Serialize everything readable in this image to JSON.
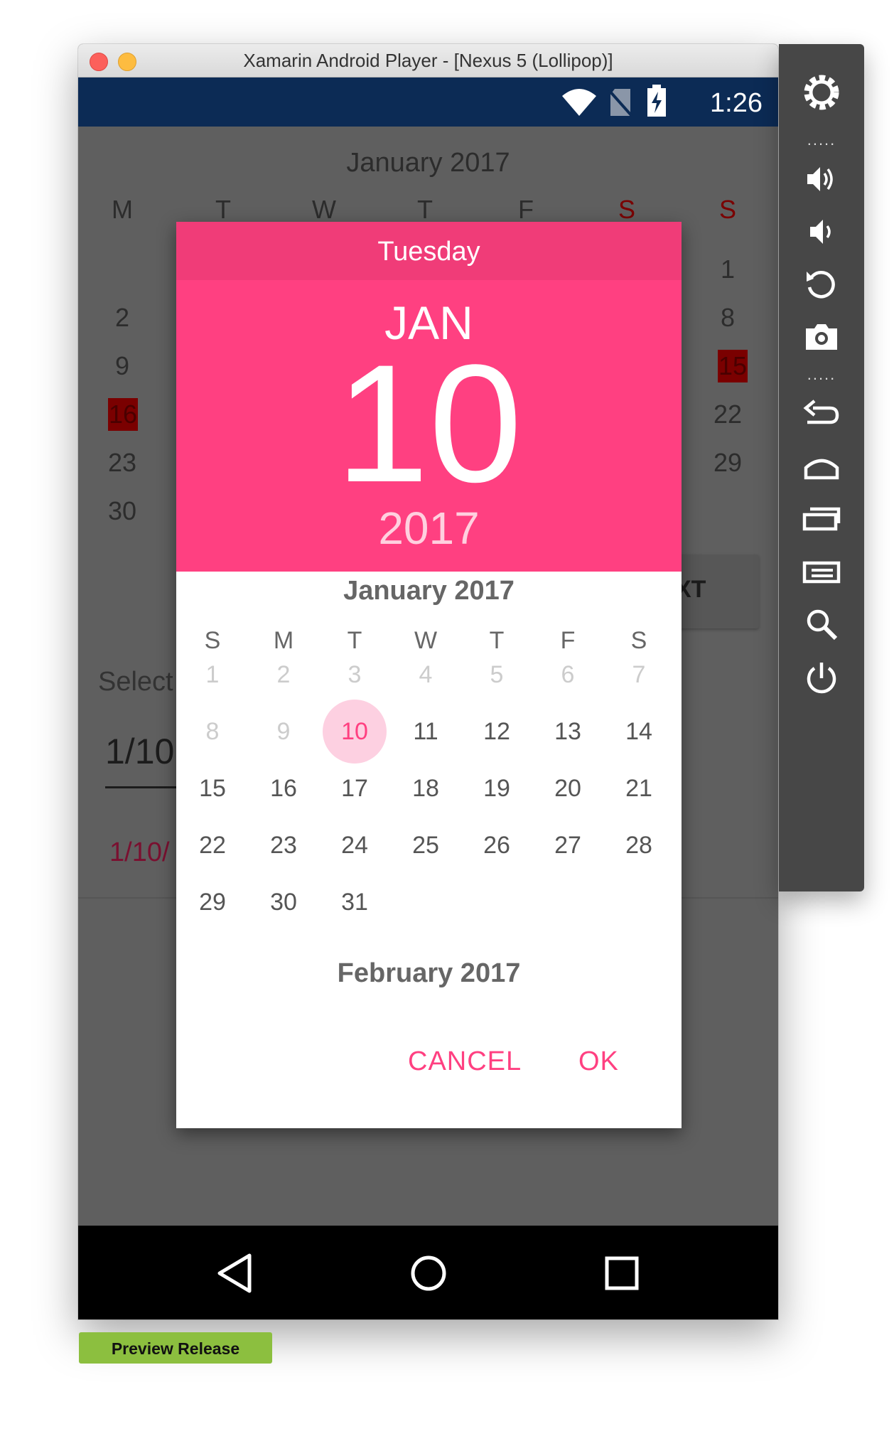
{
  "window": {
    "title": "Xamarin Android Player - [Nexus 5 (Lollipop)]"
  },
  "status_bar": {
    "time": "1:26",
    "icons": [
      "wifi-icon",
      "no-sim-icon",
      "battery-charging-icon"
    ]
  },
  "background_calendar": {
    "month_title": "January 2017",
    "weekdays": [
      "M",
      "T",
      "W",
      "T",
      "F",
      "S",
      "S"
    ],
    "visible_days": {
      "col_M": [
        "2",
        "9",
        "16",
        "23",
        "30"
      ],
      "col_S2": [
        "1",
        "8",
        "15",
        "22",
        "29"
      ]
    },
    "button_label_fragment": "XT",
    "select_label": "Select",
    "date_field_value": "1/10",
    "date_label_text": "1/10/"
  },
  "dialog": {
    "day_name": "Tuesday",
    "month_abbrev": "JAN",
    "day_number": "10",
    "year": "2017",
    "month_title": "January 2017",
    "weekdays": [
      "S",
      "M",
      "T",
      "W",
      "T",
      "F",
      "S"
    ],
    "weeks": [
      [
        "1",
        "2",
        "3",
        "4",
        "5",
        "6",
        "7"
      ],
      [
        "8",
        "9",
        "10",
        "11",
        "12",
        "13",
        "14"
      ],
      [
        "15",
        "16",
        "17",
        "18",
        "19",
        "20",
        "21"
      ],
      [
        "22",
        "23",
        "24",
        "25",
        "26",
        "27",
        "28"
      ],
      [
        "29",
        "30",
        "31"
      ]
    ],
    "selected_day": "10",
    "next_month_title": "February 2017",
    "cancel_label": "CANCEL",
    "ok_label": "OK"
  },
  "toolbar": {
    "items": [
      "settings-icon",
      "volume-up-icon",
      "volume-down-icon",
      "rotate-icon",
      "camera-icon",
      "back-icon",
      "home-icon",
      "recent-apps-icon",
      "menu-icon",
      "search-icon",
      "power-icon"
    ]
  },
  "nav_bar": {
    "buttons": [
      "back-nav-icon",
      "home-nav-icon",
      "recents-nav-icon"
    ]
  },
  "badge": {
    "label": "Preview Release"
  },
  "colors": {
    "accent": "#ff4081",
    "header_dark": "#f03c78",
    "status_bar": "#0c2b55",
    "badge": "#8cbf3f"
  }
}
